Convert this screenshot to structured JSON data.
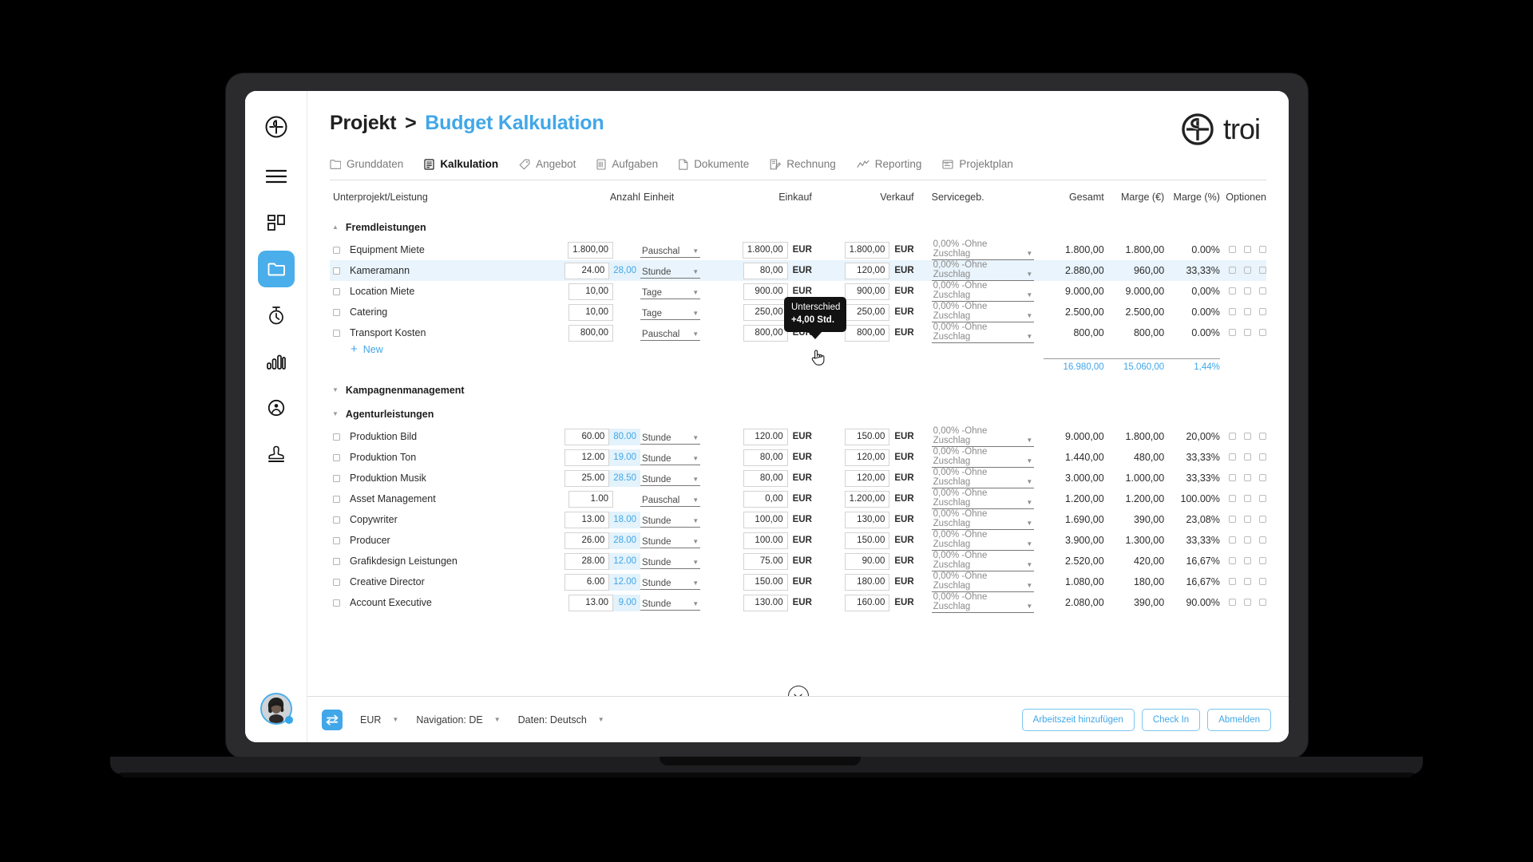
{
  "header": {
    "breadcrumb_root": "Projekt",
    "breadcrumb_sep": ">",
    "breadcrumb_current": "Budget Kalkulation",
    "brand_name": "troi",
    "accent": "#41a7e8"
  },
  "sidebar": {
    "items": [
      {
        "name": "logo",
        "icon": "troi-logo-icon",
        "active": false
      },
      {
        "name": "menu",
        "icon": "hamburger-menu-icon",
        "active": false
      },
      {
        "name": "dashboard",
        "icon": "dashboard-grid-icon",
        "active": false
      },
      {
        "name": "projects",
        "icon": "folder-icon",
        "active": true
      },
      {
        "name": "time-tracking",
        "icon": "stopwatch-icon",
        "active": false
      },
      {
        "name": "reports",
        "icon": "bar-chart-icon",
        "active": false
      },
      {
        "name": "contacts",
        "icon": "person-circle-icon",
        "active": false
      },
      {
        "name": "approvals",
        "icon": "stamp-icon",
        "active": false
      }
    ],
    "avatar_label": "user-avatar"
  },
  "tabs": [
    {
      "label": "Grunddaten",
      "icon": "folder-tab-icon",
      "active": false
    },
    {
      "label": "Kalkulation",
      "icon": "calculator-icon",
      "active": true
    },
    {
      "label": "Angebot",
      "icon": "tag-icon",
      "active": false
    },
    {
      "label": "Aufgaben",
      "icon": "tasks-icon",
      "active": false
    },
    {
      "label": "Dokumente",
      "icon": "document-icon",
      "active": false
    },
    {
      "label": "Rechnung",
      "icon": "invoice-icon",
      "active": false
    },
    {
      "label": "Reporting",
      "icon": "line-chart-icon",
      "active": false
    },
    {
      "label": "Projektplan",
      "icon": "gantt-icon",
      "active": false
    }
  ],
  "table": {
    "columns": [
      "Unterprojekt/Leistung",
      "Anzahl",
      "Einheit",
      "Einkauf",
      "Verkauf",
      "Servicegeb.",
      "Gesamt",
      "Marge (€)",
      "Marge (%)",
      "Optionen"
    ],
    "currency_label": "EUR",
    "new_row_label": "New",
    "groups": [
      {
        "label": "Fremdleistungen",
        "expanded": true,
        "caret": "▲",
        "rows": [
          {
            "name": "Equipment Miete",
            "anzahl": "1.800,00",
            "anzahl_alt": "",
            "einheit": "Pauschal",
            "einkauf": "1.800,00",
            "verkauf": "1.800,00",
            "service": "0,00% -Ohne Zuschlag",
            "gesamt": "1.800,00",
            "marge_eur": "1.800,00",
            "marge_pct": "0.00%",
            "highlight": false
          },
          {
            "name": "Kameramann",
            "anzahl": "24.00",
            "anzahl_alt": "28,00",
            "einheit": "Stunde",
            "einkauf": "80,00",
            "verkauf": "120,00",
            "service": "0,00% -Ohne Zuschlag",
            "gesamt": "2.880,00",
            "marge_eur": "960,00",
            "marge_pct": "33,33%",
            "highlight": true
          },
          {
            "name": "Location Miete",
            "anzahl": "10,00",
            "anzahl_alt": "",
            "einheit": "Tage",
            "einkauf": "900.00",
            "verkauf": "900,00",
            "service": "0,00% -Ohne Zuschlag",
            "gesamt": "9.000,00",
            "marge_eur": "9.000,00",
            "marge_pct": "0,00%",
            "highlight": false
          },
          {
            "name": "Catering",
            "anzahl": "10,00",
            "anzahl_alt": "",
            "einheit": "Tage",
            "einkauf": "250,00",
            "verkauf": "250,00",
            "service": "0,00% -Ohne Zuschlag",
            "gesamt": "2.500,00",
            "marge_eur": "2.500,00",
            "marge_pct": "0.00%",
            "highlight": false
          },
          {
            "name": "Transport Kosten",
            "anzahl": "800,00",
            "anzahl_alt": "",
            "einheit": "Pauschal",
            "einkauf": "800,00",
            "verkauf": "800,00",
            "service": "0,00% -Ohne Zuschlag",
            "gesamt": "800,00",
            "marge_eur": "800,00",
            "marge_pct": "0.00%",
            "highlight": false
          }
        ],
        "subtotal": {
          "gesamt": "16.980,00",
          "marge_eur": "15.060,00",
          "marge_pct": "1,44%"
        }
      },
      {
        "label": "Kampagnenmanagement",
        "expanded": false,
        "caret": "▼",
        "rows": [],
        "subtotal": null
      },
      {
        "label": "Agenturleistungen",
        "expanded": false,
        "caret": "▼",
        "rows": [
          {
            "name": "Produktion Bild",
            "anzahl": "60.00",
            "anzahl_alt": "80.00",
            "einheit": "Stunde",
            "einkauf": "120.00",
            "verkauf": "150.00",
            "service": "0,00% -Ohne Zuschlag",
            "gesamt": "9.000,00",
            "marge_eur": "1.800,00",
            "marge_pct": "20,00%",
            "highlight": false
          },
          {
            "name": "Produktion Ton",
            "anzahl": "12.00",
            "anzahl_alt": "19.00",
            "einheit": "Stunde",
            "einkauf": "80,00",
            "verkauf": "120,00",
            "service": "0,00% -Ohne Zuschlag",
            "gesamt": "1.440,00",
            "marge_eur": "480,00",
            "marge_pct": "33,33%",
            "highlight": false
          },
          {
            "name": "Produktion Musik",
            "anzahl": "25.00",
            "anzahl_alt": "28.50",
            "einheit": "Stunde",
            "einkauf": "80,00",
            "verkauf": "120,00",
            "service": "0,00% -Ohne Zuschlag",
            "gesamt": "3.000,00",
            "marge_eur": "1.000,00",
            "marge_pct": "33,33%",
            "highlight": false
          },
          {
            "name": "Asset Management",
            "anzahl": "1.00",
            "anzahl_alt": "",
            "einheit": "Pauschal",
            "einkauf": "0,00",
            "verkauf": "1.200,00",
            "service": "0,00% -Ohne Zuschlag",
            "gesamt": "1.200,00",
            "marge_eur": "1.200,00",
            "marge_pct": "100.00%",
            "highlight": false
          },
          {
            "name": "Copywriter",
            "anzahl": "13.00",
            "anzahl_alt": "18.00",
            "einheit": "Stunde",
            "einkauf": "100,00",
            "verkauf": "130,00",
            "service": "0,00% -Ohne Zuschlag",
            "gesamt": "1.690,00",
            "marge_eur": "390,00",
            "marge_pct": "23,08%",
            "highlight": false
          },
          {
            "name": "Producer",
            "anzahl": "26.00",
            "anzahl_alt": "28.00",
            "einheit": "Stunde",
            "einkauf": "100.00",
            "verkauf": "150.00",
            "service": "0,00% -Ohne Zuschlag",
            "gesamt": "3.900,00",
            "marge_eur": "1.300,00",
            "marge_pct": "33,33%",
            "highlight": false
          },
          {
            "name": "Grafikdesign Leistungen",
            "anzahl": "28.00",
            "anzahl_alt": "12.00",
            "einheit": "Stunde",
            "einkauf": "75.00",
            "verkauf": "90.00",
            "service": "0,00% -Ohne Zuschlag",
            "gesamt": "2.520,00",
            "marge_eur": "420,00",
            "marge_pct": "16,67%",
            "highlight": false
          },
          {
            "name": "Creative Director",
            "anzahl": "6.00",
            "anzahl_alt": "12.00",
            "einheit": "Stunde",
            "einkauf": "150.00",
            "verkauf": "180.00",
            "service": "0,00% -Ohne Zuschlag",
            "gesamt": "1.080,00",
            "marge_eur": "180,00",
            "marge_pct": "16,67%",
            "highlight": false
          },
          {
            "name": "Account Executive",
            "anzahl": "13.00",
            "anzahl_alt": "9.00",
            "einheit": "Stunde",
            "einkauf": "130.00",
            "verkauf": "160.00",
            "service": "0,00% -Ohne Zuschlag",
            "gesamt": "2.080,00",
            "marge_eur": "390,00",
            "marge_pct": "90.00%",
            "highlight": false
          }
        ],
        "subtotal": null
      }
    ]
  },
  "tooltip": {
    "title": "Unterschied",
    "value": "+4,00 Std."
  },
  "footer": {
    "swap_icon": "swap-arrows-icon",
    "currency": "EUR",
    "navigation": "Navigation: DE",
    "data_language": "Daten: Deutsch",
    "buttons": [
      {
        "label": "Arbeitszeit hinzufügen"
      },
      {
        "label": "Check In"
      },
      {
        "label": "Abmelden"
      }
    ]
  }
}
